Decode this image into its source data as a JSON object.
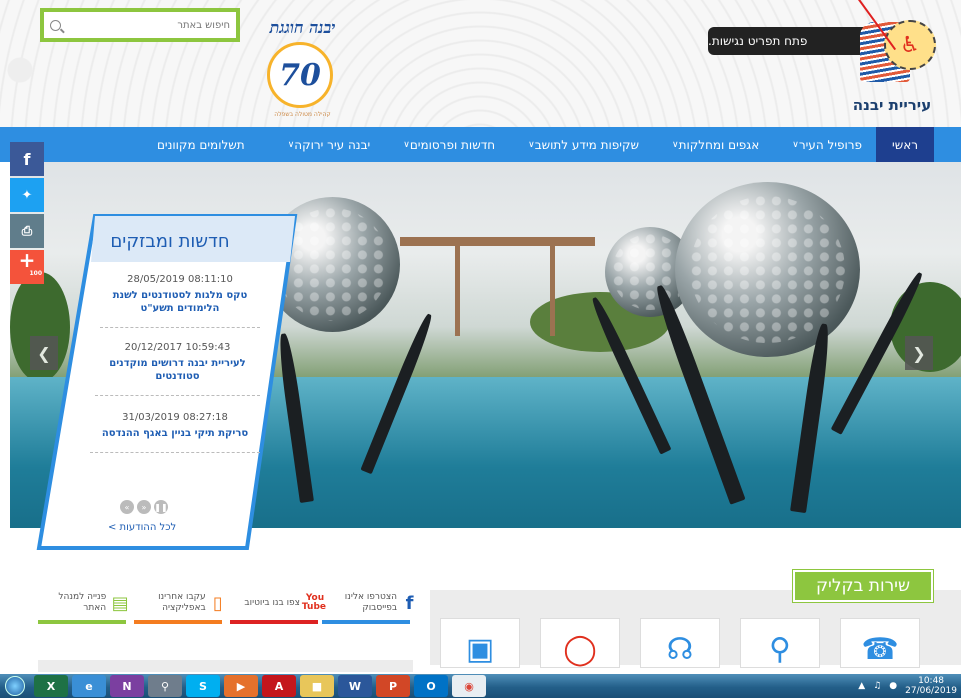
{
  "search": {
    "placeholder": "חיפוש באתר"
  },
  "anniversary_logo": {
    "title": "יבנה חוגגת",
    "number": "70",
    "subtitle": "קהילה מטולה בשפלה"
  },
  "accessibility": {
    "label": "פתח תפריט נגישות.",
    "icon": "wheelchair-icon"
  },
  "city_logo": {
    "name": "עיריית יבנה"
  },
  "nav": {
    "items": [
      {
        "label": "ראשי"
      },
      {
        "label": "פרופיל העיר"
      },
      {
        "label": "אגפים ומחלקות"
      },
      {
        "label": "שקיפות מידע לתושב"
      },
      {
        "label": "חדשות ופרסומים"
      },
      {
        "label": "יבנה עיר ירוקה"
      },
      {
        "label": "תשלומים מקוונים"
      }
    ]
  },
  "social": {
    "count": "100",
    "colors": {
      "facebook": "#3b5998",
      "twitter": "#1da1f2",
      "print": "#607d8b",
      "share": "#f4533b"
    }
  },
  "news": {
    "title": "חדשות ומבזקים",
    "items": [
      {
        "date": "08:11:10 28/05/2019",
        "text": "טקס מלגות לסטודנטים לשנת הלימודים תשע\"ט"
      },
      {
        "date": "10:59:43 20/12/2017",
        "text": "לעיריית יבנה דרושים מוקדנים סטודנטים"
      },
      {
        "date": "08:27:18 31/03/2019",
        "text": "סריקת תיקי בניין באגף ההנדסה"
      }
    ],
    "all_link": "לכל ההודעות >"
  },
  "services": {
    "title": "שירות בקליק"
  },
  "links": [
    {
      "text": "הצטרפו אלינו בפייסבוק",
      "icon": "facebook-icon"
    },
    {
      "text": "צפו בנו ביוטיוב",
      "icon": "youtube-icon",
      "badge_top": "You",
      "badge_bottom": "Tube"
    },
    {
      "text": "עקבו אחרינו באפליקציה",
      "icon": "phone-icon"
    },
    {
      "text": "פנייה למנהל האתר",
      "icon": "chat-icon"
    }
  ],
  "taskbar": {
    "time": "10:48",
    "date": "27/06/2019"
  },
  "colors": {
    "nav": "#2e8ee1",
    "nav_active": "#1e3f8f",
    "green": "#8dc63f",
    "link_blue": "#1e5db3"
  }
}
